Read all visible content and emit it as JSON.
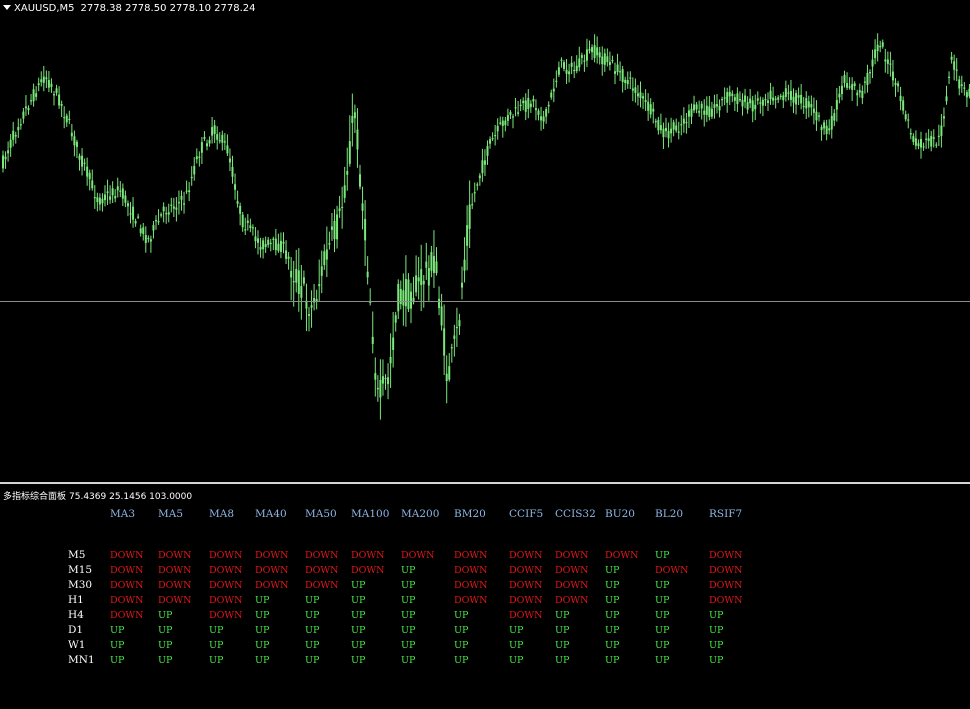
{
  "chart": {
    "symbol": "XAUUSD,M5",
    "ohlc": "2778.38 2778.50 2778.10 2778.24",
    "candle_color": "#7ae87a",
    "background": "#000000"
  },
  "indicator": {
    "title": "多指标综合面板",
    "values": "75.4369 25.1456 103.0000",
    "up_color": "#47e647",
    "down_color": "#e01818",
    "header_color": "#8fb7e6",
    "columns": [
      "MA3",
      "MA5",
      "MA8",
      "MA40",
      "MA50",
      "MA100",
      "MA200",
      "BM20",
      "CCIF5",
      "CCIS32",
      "BU20",
      "BL20",
      "RSIF7"
    ],
    "rows": [
      {
        "tf": "M5",
        "signals": [
          "DOWN",
          "DOWN",
          "DOWN",
          "DOWN",
          "DOWN",
          "DOWN",
          "DOWN",
          "DOWN",
          "DOWN",
          "DOWN",
          "DOWN",
          "UP",
          "DOWN"
        ]
      },
      {
        "tf": "M15",
        "signals": [
          "DOWN",
          "DOWN",
          "DOWN",
          "DOWN",
          "DOWN",
          "DOWN",
          "UP",
          "DOWN",
          "DOWN",
          "DOWN",
          "UP",
          "DOWN",
          "DOWN"
        ]
      },
      {
        "tf": "M30",
        "signals": [
          "DOWN",
          "DOWN",
          "DOWN",
          "DOWN",
          "DOWN",
          "UP",
          "UP",
          "DOWN",
          "DOWN",
          "DOWN",
          "UP",
          "UP",
          "DOWN"
        ]
      },
      {
        "tf": "H1",
        "signals": [
          "DOWN",
          "DOWN",
          "DOWN",
          "UP",
          "UP",
          "UP",
          "UP",
          "DOWN",
          "DOWN",
          "DOWN",
          "UP",
          "UP",
          "DOWN"
        ]
      },
      {
        "tf": "H4",
        "signals": [
          "DOWN",
          "UP",
          "DOWN",
          "UP",
          "UP",
          "UP",
          "UP",
          "UP",
          "DOWN",
          "UP",
          "UP",
          "UP",
          "UP"
        ]
      },
      {
        "tf": "D1",
        "signals": [
          "UP",
          "UP",
          "UP",
          "UP",
          "UP",
          "UP",
          "UP",
          "UP",
          "UP",
          "UP",
          "UP",
          "UP",
          "UP"
        ]
      },
      {
        "tf": "W1",
        "signals": [
          "UP",
          "UP",
          "UP",
          "UP",
          "UP",
          "UP",
          "UP",
          "UP",
          "UP",
          "UP",
          "UP",
          "UP",
          "UP"
        ]
      },
      {
        "tf": "MN1",
        "signals": [
          "UP",
          "UP",
          "UP",
          "UP",
          "UP",
          "UP",
          "UP",
          "UP",
          "UP",
          "UP",
          "UP",
          "UP",
          "UP"
        ]
      }
    ]
  }
}
